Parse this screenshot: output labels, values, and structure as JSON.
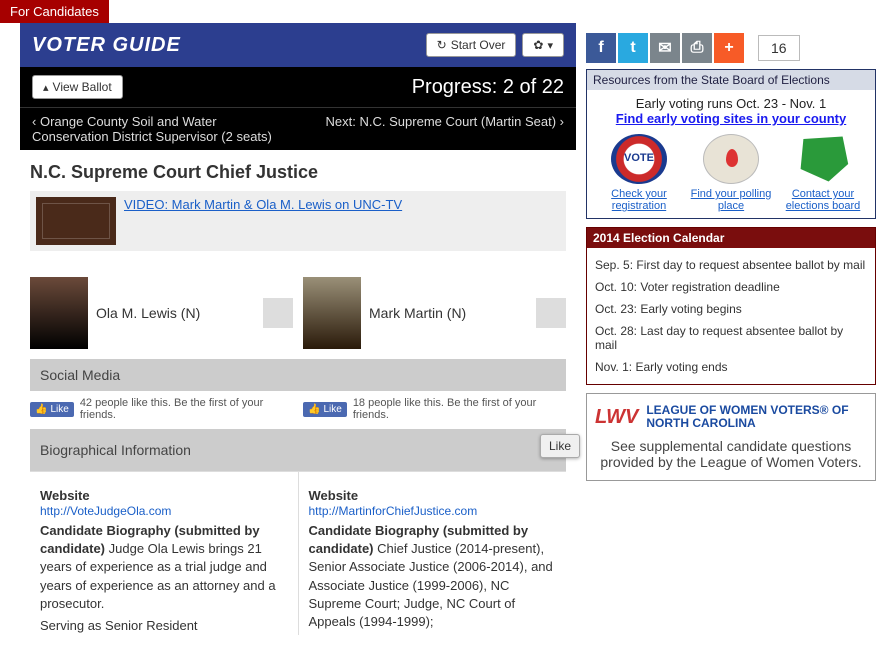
{
  "topbar": {
    "label": "For Candidates"
  },
  "header": {
    "title": "VOTER GUIDE",
    "start_over": "Start Over",
    "gear_label": ""
  },
  "toolbar": {
    "view_ballot": "View Ballot",
    "progress": "Progress: 2 of 22",
    "prev": "Orange County Soil and Water Conservation District Supervisor (2 seats)",
    "next_label": "Next:",
    "next": "N.C. Supreme Court (Martin Seat)"
  },
  "race": {
    "title": "N.C. Supreme Court Chief Justice",
    "video_link": "VIDEO: Mark Martin & Ola M. Lewis on UNC-TV"
  },
  "candidates": [
    {
      "name": "Ola M. Lewis (N)"
    },
    {
      "name": "Mark Martin (N)"
    }
  ],
  "sections": {
    "social": "Social Media",
    "bio": "Biographical Information"
  },
  "likes": [
    {
      "btn": "Like",
      "text": "42 people like this. Be the first of your friends."
    },
    {
      "btn": "Like",
      "text": "18 people like this. Be the first of your friends."
    }
  ],
  "bio": {
    "left": {
      "website_label": "Website",
      "website": "http://VoteJudgeOla.com",
      "bio_label": "Candidate Biography (submitted by candidate)",
      "bio1": "Judge Ola Lewis brings 21 years of experience as a trial judge and years of experience as an attorney and a prosecutor.",
      "bio2": "Serving as Senior Resident"
    },
    "right": {
      "website_label": "Website",
      "website": "http://MartinforChiefJustice.com",
      "bio_label": "Candidate Biography (submitted by candidate)",
      "bio1": "Chief Justice (2014-present), Senior Associate Justice (2006-2014), and Associate Justice (1999-2006), NC Supreme Court; Judge, NC Court of Appeals (1994-1999);"
    }
  },
  "share": {
    "count": "16"
  },
  "resources": {
    "header": "Resources from the State Board of Elections",
    "line1": "Early voting runs Oct. 23 - Nov. 1",
    "line2": "Find early voting sites in your county",
    "items": [
      {
        "label": "Check your registration"
      },
      {
        "label": "Find your polling place"
      },
      {
        "label": "Contact your elections board"
      }
    ]
  },
  "calendar": {
    "header": "2014 Election Calendar",
    "items": [
      "Sep. 5: First day to request absentee ballot by mail",
      "Oct. 10: Voter registration deadline",
      "Oct. 23: Early voting begins",
      "Oct. 28: Last day to request absentee ballot by mail",
      "Nov. 1: Early voting ends"
    ]
  },
  "like_float": "Like",
  "lwv": {
    "name": "LEAGUE OF WOMEN VOTERS® OF NORTH CAROLINA",
    "text": "See supplemental candidate questions provided by the League of Women Voters."
  }
}
